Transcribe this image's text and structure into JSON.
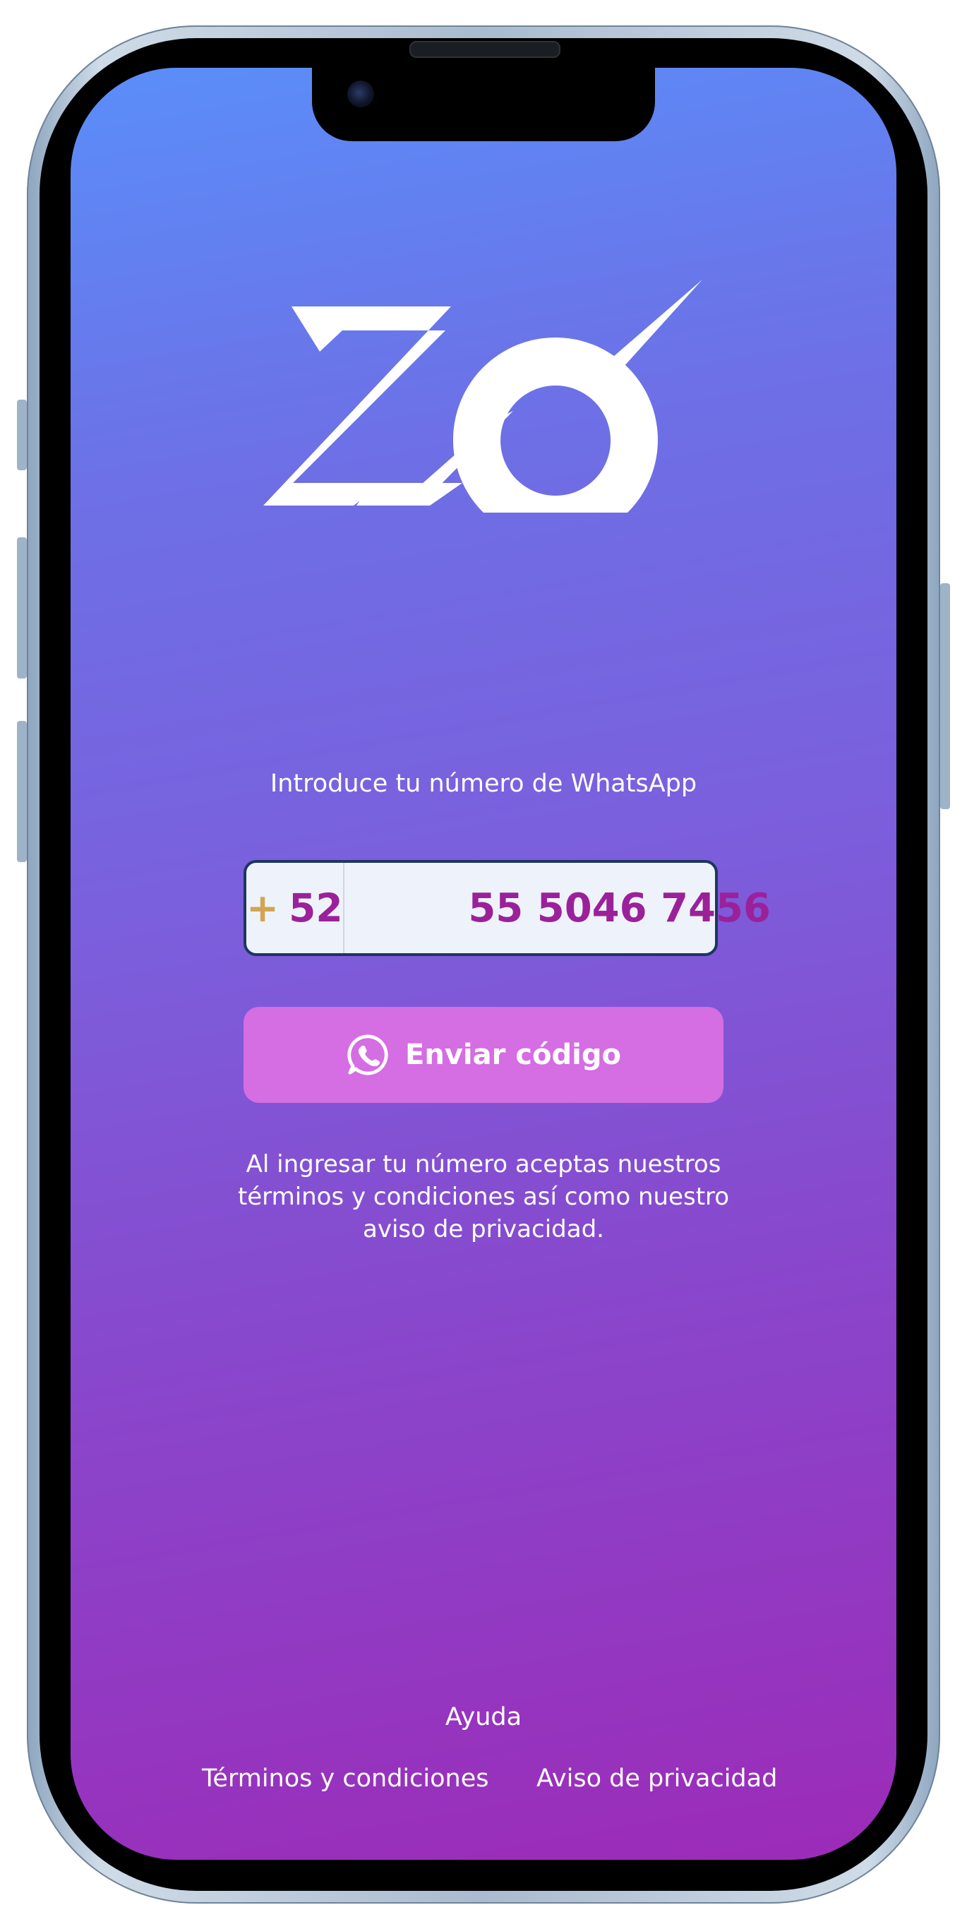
{
  "brand": {
    "logo_text": "ZO"
  },
  "login": {
    "prompt": "Introduce tu número de WhatsApp",
    "country_plus": "+",
    "country_code": "52",
    "phone_number": "55 5046 7456",
    "send_button_label": "Enviar código",
    "legal_text": "Al ingresar tu número aceptas nuestros términos y condiciones así como nuestro aviso de privacidad."
  },
  "footer": {
    "help": "Ayuda",
    "terms": "Términos y condiciones",
    "privacy": "Aviso de privacidad"
  },
  "icons": {
    "send_button_icon": "whatsapp-icon"
  },
  "colors": {
    "gradient_top": "#5a8ef9",
    "gradient_bottom": "#9c2bb8",
    "accent_text": "#9b219a",
    "plus_color": "#d2a552",
    "button_bg": "#d56de3",
    "field_border": "#1d3661"
  }
}
